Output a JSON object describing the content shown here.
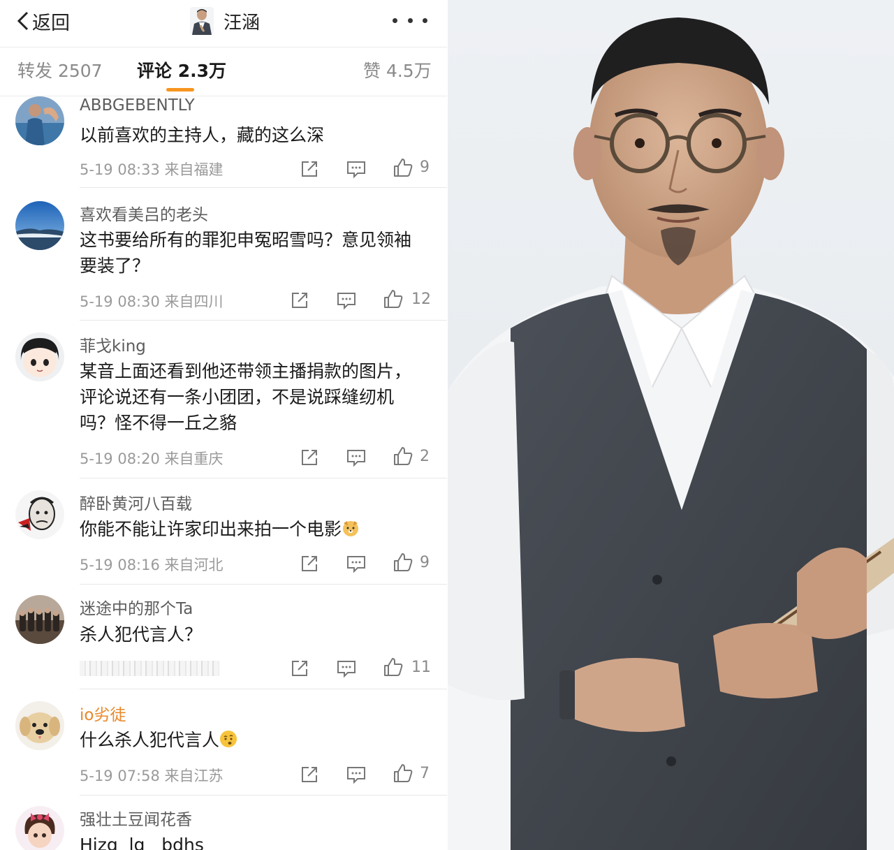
{
  "header": {
    "back_label": "返回",
    "title": "汪涵"
  },
  "tabs": {
    "repost": "转发 2507",
    "comments": "评论 2.3万",
    "likes": "赞 4.5万"
  },
  "colors": {
    "accent": "#f79520",
    "vip_name": "#e8882a"
  },
  "comments": [
    {
      "user": "ABBGEBENTLY",
      "text": "以前喜欢的主持人，藏的这么深",
      "meta": "5-19 08:33 来自福建",
      "likes": "9"
    },
    {
      "user": "喜欢看美吕的老头",
      "text": "这书要给所有的罪犯申冤昭雪吗？意见领袖要装了？",
      "meta": "5-19 08:30 来自四川",
      "likes": "12"
    },
    {
      "user": "菲戈king",
      "text": "某音上面还看到他还带领主播捐款的图片，评论说还有一条小团团，不是说踩缝纫机吗？怪不得一丘之貉",
      "meta": "5-19 08:20 来自重庆",
      "likes": "2"
    },
    {
      "user": "醉卧黄河八百载",
      "text": "你能不能让许家印出来拍一个电影",
      "meta": "5-19 08:16 来自河北",
      "likes": "9"
    },
    {
      "user": "迷途中的那个Ta",
      "text": "杀人犯代言人？",
      "meta": "",
      "likes": "11"
    },
    {
      "user": "io劣徒",
      "text": "什么杀人犯代言人",
      "meta": "5-19 07:58 来自江苏",
      "likes": "7"
    },
    {
      "user": "强壮土豆闻花香",
      "text": "Hizg  lg   bdhs",
      "meta": "",
      "likes": ""
    }
  ],
  "icons": [
    "back-chevron-icon",
    "more-icon",
    "repost-icon",
    "comment-icon",
    "thumbs-up-icon",
    "dog-emoji-icon",
    "thinking-emoji-icon"
  ]
}
